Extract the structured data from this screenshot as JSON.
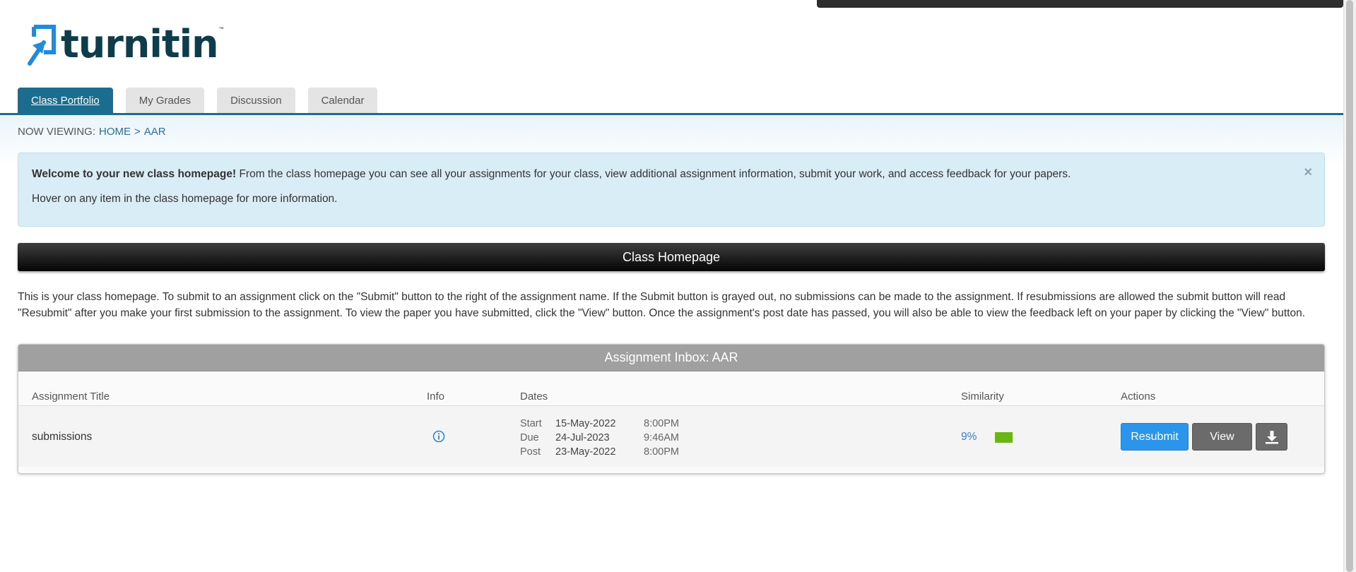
{
  "logo": {
    "text": "turnitin",
    "tm": "™"
  },
  "tabs": [
    {
      "label": "Class Portfolio",
      "active": true
    },
    {
      "label": "My Grades",
      "active": false
    },
    {
      "label": "Discussion",
      "active": false
    },
    {
      "label": "Calendar",
      "active": false
    }
  ],
  "breadcrumb": {
    "prefix": "NOW VIEWING:",
    "home": "HOME",
    "separator": ">",
    "current": "AAR"
  },
  "welcome": {
    "bold": "Welcome to your new class homepage!",
    "text": "From the class homepage you can see all your assignments for your class, view additional assignment information, submit your work, and access feedback for your papers.",
    "hint": "Hover on any item in the class homepage for more information.",
    "close_icon": "×"
  },
  "class_bar": {
    "title": "Class Homepage"
  },
  "description": "This is your class homepage. To submit to an assignment click on the \"Submit\" button to the right of the assignment name. If the Submit button is grayed out, no submissions can be made to the assignment. If resubmissions are allowed the submit button will read \"Resubmit\" after you make your first submission to the assignment. To view the paper you have submitted, click the \"View\" button. Once the assignment's post date has passed, you will also be able to view the feedback left on your paper by clicking the \"View\" button.",
  "inbox": {
    "title": "Assignment Inbox: AAR",
    "columns": {
      "title": "Assignment Title",
      "info": "Info",
      "dates": "Dates",
      "similarity": "Similarity",
      "actions": "Actions"
    },
    "row": {
      "title": "submissions",
      "info_icon": "info-icon",
      "dates": [
        {
          "label": "Start",
          "date": "15-May-2022",
          "time": "8:00PM"
        },
        {
          "label": "Due",
          "date": "24-Jul-2023",
          "time": "9:46AM"
        },
        {
          "label": "Post",
          "date": "23-May-2022",
          "time": "8:00PM"
        }
      ],
      "similarity": "9%",
      "similarity_color": "#6cb517",
      "resubmit_label": "Resubmit",
      "view_label": "View",
      "download_icon": "download-icon"
    }
  },
  "colors": {
    "brand": "#1b6d8f",
    "alert_bg": "#d9edf7",
    "primary_button": "#2b95ec",
    "secondary_button": "#6b6b6b"
  }
}
